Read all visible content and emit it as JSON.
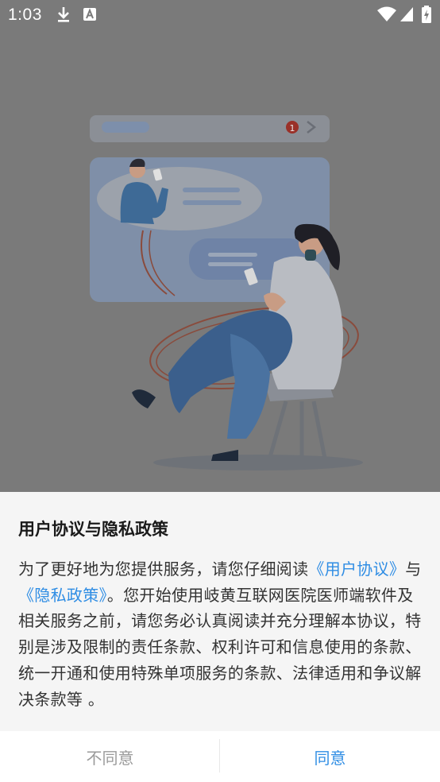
{
  "status_bar": {
    "time": "1:03",
    "left_icons": [
      "download-icon",
      "font-a-icon"
    ],
    "right_icons": [
      "wifi-icon",
      "signal-icon",
      "battery-charging-icon"
    ]
  },
  "illustration": {
    "notification_count": "1"
  },
  "dialog": {
    "title": "用户协议与隐私政策",
    "body_intro": "为了更好地为您提供服务，请您仔细阅读",
    "user_agreement_link": "《用户协议》",
    "connector": "与",
    "privacy_policy_link": "《隐私政策》",
    "body_rest": "。您开始使用岐黄互联网医院医师端软件及相关服务之前，请您务必认真阅读并充分理解本协议，特别是涉及限制的责任条款、权利许可和信息使用的条款、统一开通和使用特殊单项服务的条款、法律适用和争议解决条款等 。"
  },
  "buttons": {
    "disagree_label": "不同意",
    "agree_label": "同意"
  },
  "colors": {
    "overlay": "#7a7a7a",
    "sheet_bg": "#f5f5f5",
    "link": "#2f8de4",
    "disagree_text": "#9a9a9a"
  }
}
